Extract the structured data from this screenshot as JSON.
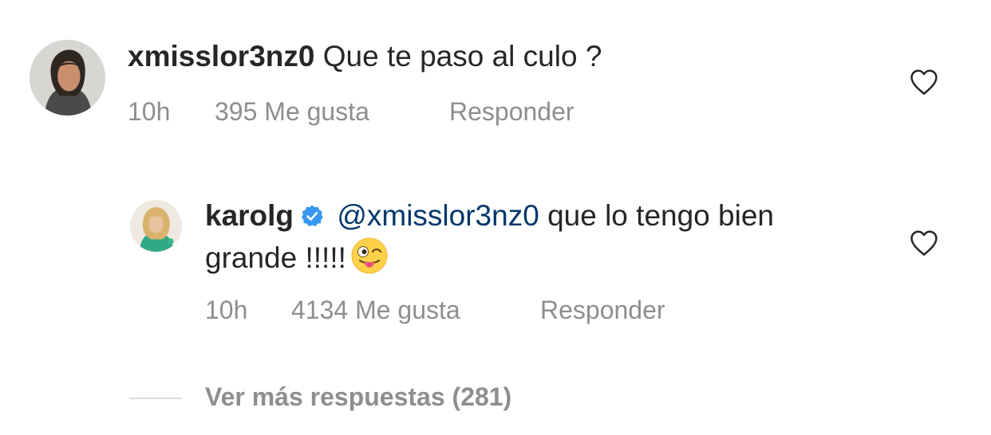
{
  "comments": [
    {
      "username": "xmisslor3nz0",
      "text": "Que te paso al culo ?",
      "time": "10h",
      "likes": "395 Me gusta",
      "reply_label": "Responder",
      "avatar_icon": "user-avatar-photo",
      "like_icon": "heart-outline-icon"
    },
    {
      "username": "karolg",
      "verified": true,
      "mention": "@xmisslor3nz0",
      "text": "que lo tengo bien grande !!!!!",
      "emoji": "winking-face-with-tongue",
      "time": "10h",
      "likes": "4134 Me gusta",
      "reply_label": "Responder",
      "avatar_icon": "user-avatar-photo",
      "like_icon": "heart-outline-icon"
    }
  ],
  "view_more": "Ver más respuestas (281)",
  "colors": {
    "text": "#262626",
    "secondary": "#8e8e8e",
    "mention": "#00376b",
    "verified": "#3897f0",
    "divider": "#dbdbdb"
  }
}
